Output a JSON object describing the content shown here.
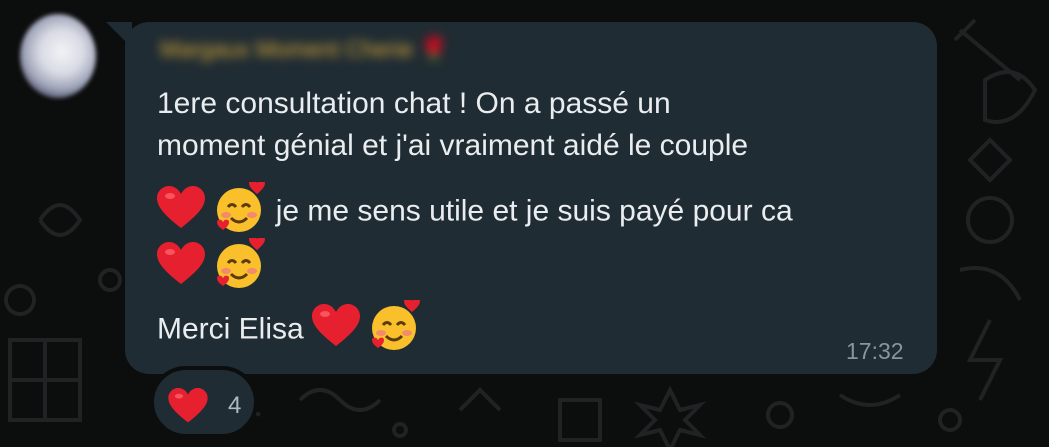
{
  "chat": {
    "sender_name": "Margaux Moment Cherie 🌹",
    "message_lines": [
      "1ere consultation chat ! On a passé un",
      "moment génial et j'ai vraiment aidé le couple",
      "je me sens utile et je suis payé pour ca",
      "Merci Elisa"
    ],
    "time": "17:32",
    "reaction": {
      "emoji_icon": "red-heart-icon",
      "count": "4"
    }
  },
  "colors": {
    "background": "#0c0d0d",
    "bubble": "#202c33",
    "text": "#e9edef",
    "timestamp": "#8696a0",
    "sender": "#d9a93a"
  },
  "icons": [
    "red-heart-icon",
    "smiling-face-with-hearts-icon"
  ]
}
